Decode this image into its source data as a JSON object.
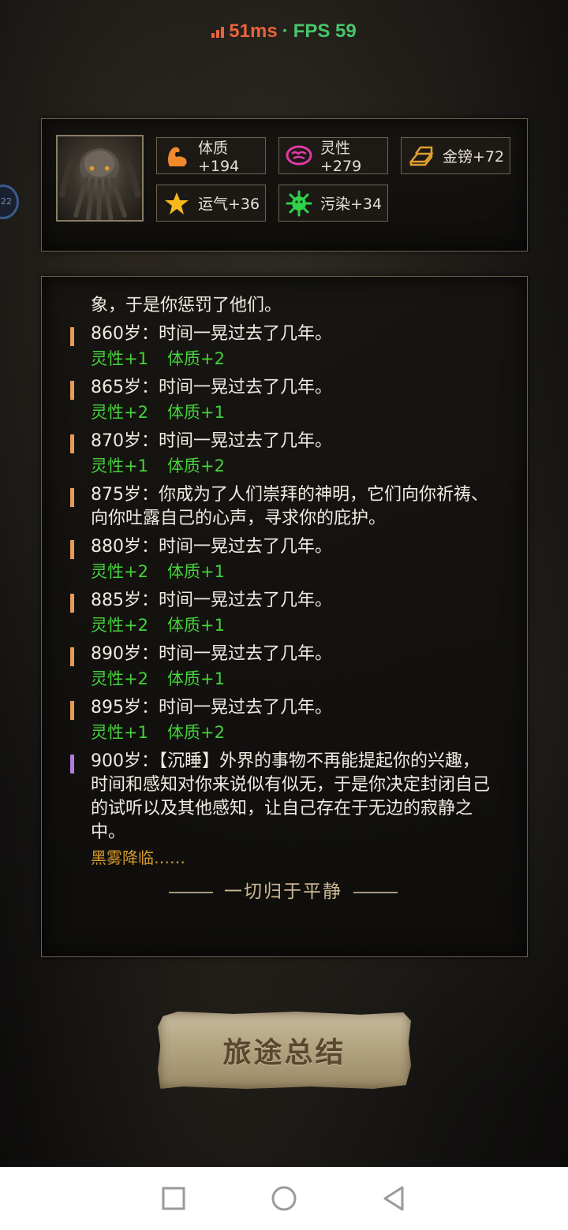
{
  "status": {
    "ping": "51ms",
    "separator": "·",
    "fps": "FPS 59",
    "ping_color": "#e8623a",
    "fps_color": "#49c46a"
  },
  "side_bubble": {
    "text": "22"
  },
  "stats": [
    {
      "icon": "flexed-arm-icon",
      "label": "体质+194"
    },
    {
      "icon": "brain-icon",
      "label": "灵性+279"
    },
    {
      "icon": "gold-bars-icon",
      "label": "金镑+72"
    },
    {
      "icon": "star-icon",
      "label": "运气+36"
    },
    {
      "icon": "germ-icon",
      "label": "污染+34"
    }
  ],
  "log": {
    "intro": "象，于是你惩罚了他们。",
    "entries": [
      {
        "text": "860岁：时间一晃过去了几年。",
        "attrs": [
          "灵性+1",
          "体质+2"
        ]
      },
      {
        "text": "865岁：时间一晃过去了几年。",
        "attrs": [
          "灵性+2",
          "体质+1"
        ]
      },
      {
        "text": "870岁：时间一晃过去了几年。",
        "attrs": [
          "灵性+1",
          "体质+2"
        ]
      },
      {
        "text": "875岁：你成为了人们崇拜的神明，它们向你祈祷、向你吐露自己的心声，寻求你的庇护。",
        "attrs": []
      },
      {
        "text": "880岁：时间一晃过去了几年。",
        "attrs": [
          "灵性+2",
          "体质+1"
        ]
      },
      {
        "text": "885岁：时间一晃过去了几年。",
        "attrs": [
          "灵性+2",
          "体质+1"
        ]
      },
      {
        "text": "890岁：时间一晃过去了几年。",
        "attrs": [
          "灵性+2",
          "体质+1"
        ]
      },
      {
        "text": "895岁：时间一晃过去了几年。",
        "attrs": [
          "灵性+1",
          "体质+2"
        ]
      }
    ],
    "final_entry": "900岁：【沉睡】外界的事物不再能提起你的兴趣，时间和感知对你来说似有似无，于是你决定封闭自己的试听以及其他感知，让自己存在于无边的寂静之中。",
    "fog_text": "黑雾降临……",
    "ending": "一切归于平静"
  },
  "summary_button": {
    "label": "旅途总结"
  },
  "colors": {
    "attr_green": "#46d23c",
    "entry_bar_orange": "#e99a56",
    "entry_bar_purple": "#b47ae0",
    "fog_gold": "#d59a2c"
  }
}
